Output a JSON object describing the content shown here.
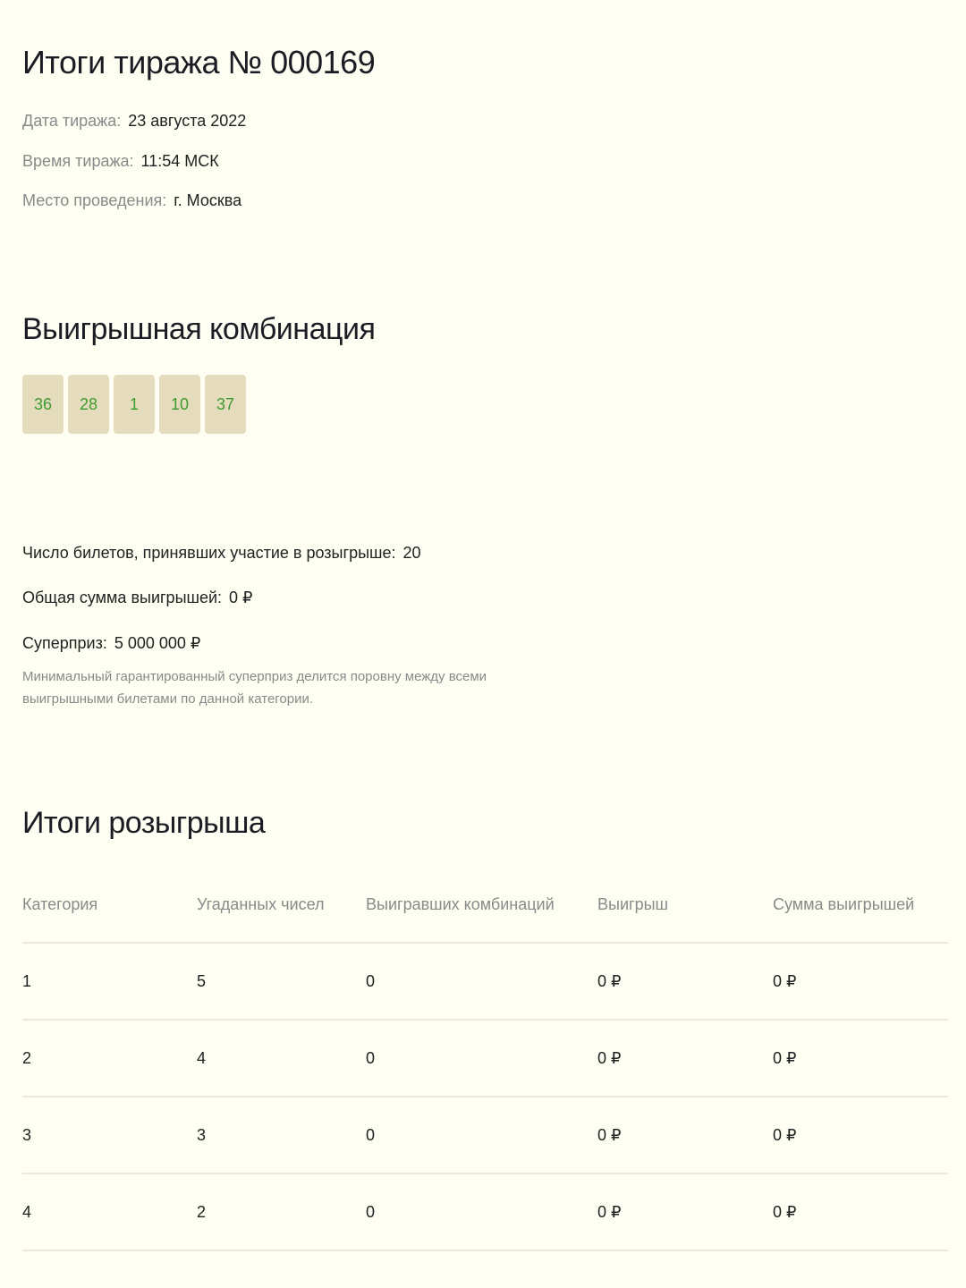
{
  "header": {
    "title": "Итоги тиража № 000169",
    "date_label": "Дата тиража:",
    "date_value": "23 августа 2022",
    "time_label": "Время тиража:",
    "time_value": "11:54 МСК",
    "place_label": "Место проведения:",
    "place_value": "г. Москва"
  },
  "combination": {
    "title": "Выигрышная комбинация",
    "numbers": [
      "36",
      "28",
      "1",
      "10",
      "37"
    ],
    "ball_color": "#e5dcbd",
    "number_color": "#3f9a2f"
  },
  "stats": {
    "tickets_label": "Число билетов, принявших участие в розыгрыше:",
    "tickets_value": "20",
    "total_label": "Общая сумма выигрышей:",
    "total_value": "0 ₽",
    "superprize_label": "Суперприз:",
    "superprize_value": "5 000 000 ₽",
    "note": "Минимальный гарантированный суперприз делится поровну между всеми выигрышными билетами по данной категории."
  },
  "results": {
    "title": "Итоги розыгрыша",
    "columns": [
      "Категория",
      "Угаданных чисел",
      "Выигравших комбинаций",
      "Выигрыш",
      "Сумма выигрышей"
    ],
    "rows": [
      [
        "1",
        "5",
        "0",
        "0 ₽",
        "0 ₽"
      ],
      [
        "2",
        "4",
        "0",
        "0 ₽",
        "0 ₽"
      ],
      [
        "3",
        "3",
        "0",
        "0 ₽",
        "0 ₽"
      ],
      [
        "4",
        "2",
        "0",
        "0 ₽",
        "0 ₽"
      ]
    ]
  }
}
